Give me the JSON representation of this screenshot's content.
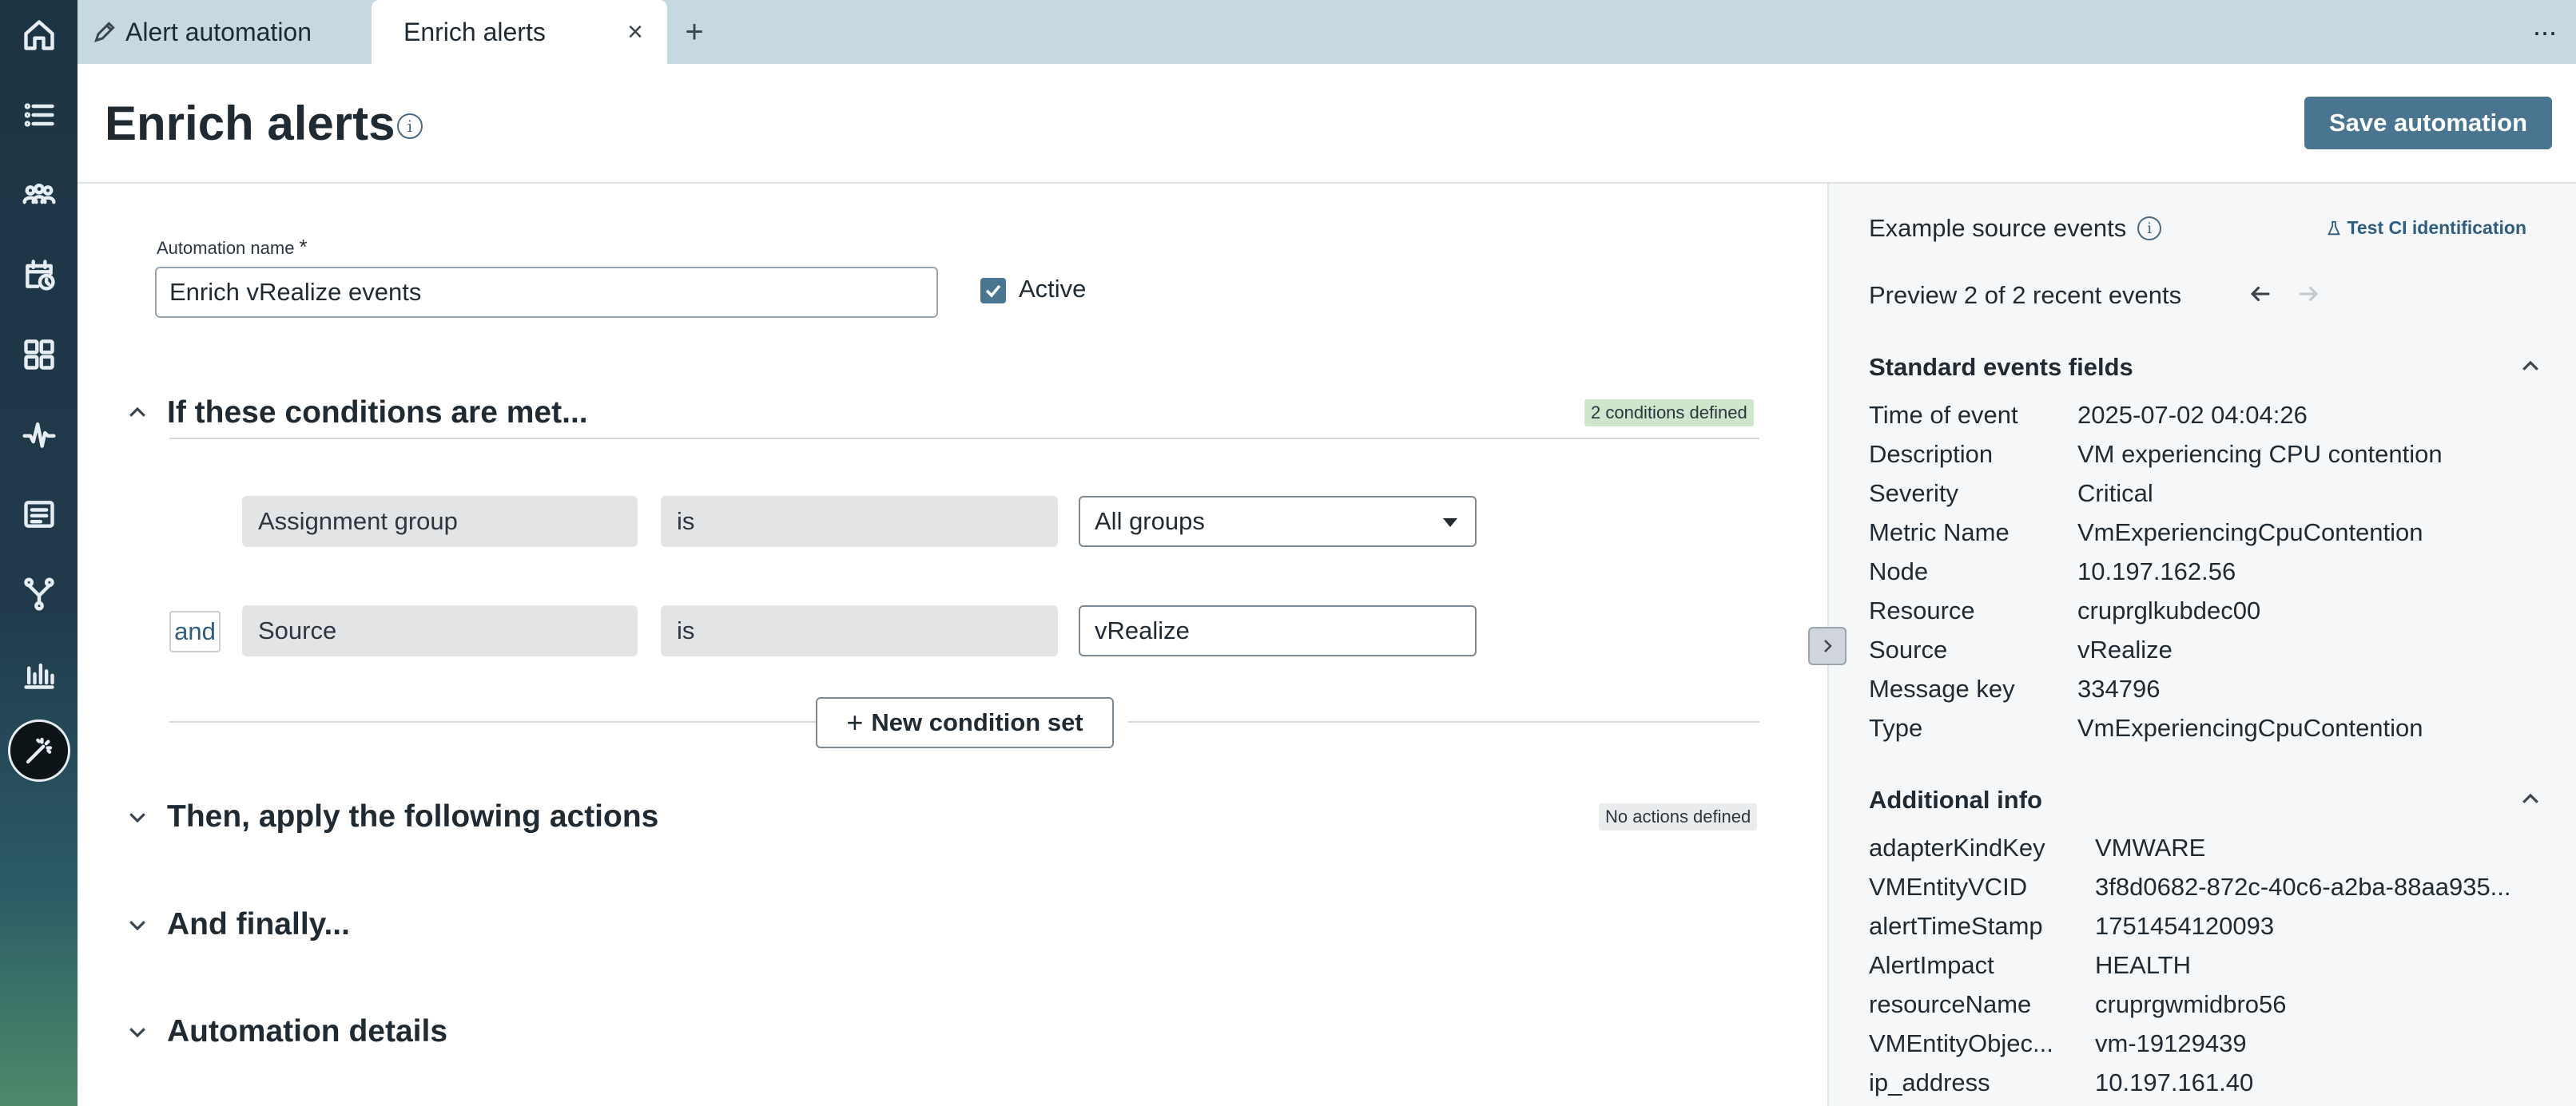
{
  "tabs": [
    {
      "label": "Alert automation"
    },
    {
      "label": "Enrich alerts"
    }
  ],
  "header": {
    "title": "Enrich alerts",
    "info_glyph": "i",
    "save_label": "Save automation"
  },
  "form": {
    "name_label": "Automation name",
    "required_mark": "*",
    "name_value": "Enrich vRealize events",
    "active_label": "Active",
    "active_checked": true
  },
  "conditions": {
    "title": "If these conditions are met...",
    "badge": "2 conditions defined",
    "rows": [
      {
        "field": "Assignment group",
        "operator": "is",
        "value": "All groups",
        "dropdown": true
      },
      {
        "connector": "and",
        "field": "Source",
        "operator": "is",
        "value": "vRealize",
        "dropdown": false
      }
    ],
    "new_condition_label": "New condition set"
  },
  "actions": {
    "title": "Then, apply the following actions",
    "badge": "No actions defined"
  },
  "finally": {
    "title": "And finally..."
  },
  "details": {
    "title": "Automation details"
  },
  "panel": {
    "title": "Example source events",
    "test_ci_label": "Test CI identification",
    "preview_text": "Preview 2 of 2 recent events",
    "standard_title": "Standard events fields",
    "standard_fields": [
      {
        "key": "Time of event",
        "value": "2025-07-02 04:04:26"
      },
      {
        "key": "Description",
        "value": "VM experiencing CPU contention"
      },
      {
        "key": "Severity",
        "value": "Critical"
      },
      {
        "key": "Metric Name",
        "value": "VmExperiencingCpuContention"
      },
      {
        "key": "Node",
        "value": "10.197.162.56"
      },
      {
        "key": "Resource",
        "value": "cruprglkubdec00"
      },
      {
        "key": "Source",
        "value": "vRealize"
      },
      {
        "key": "Message key",
        "value": "334796"
      },
      {
        "key": "Type",
        "value": "VmExperiencingCpuContention"
      }
    ],
    "additional_title": "Additional info",
    "additional_fields": [
      {
        "key": "adapterKindKey",
        "value": "VMWARE"
      },
      {
        "key": "VMEntityVCID",
        "value": "3f8d0682-872c-40c6-a2ba-88aa935..."
      },
      {
        "key": "alertTimeStamp",
        "value": "1751454120093"
      },
      {
        "key": "AlertImpact",
        "value": "HEALTH"
      },
      {
        "key": "resourceName",
        "value": "cruprgwmidbro56"
      },
      {
        "key": "VMEntityObjec...",
        "value": "vm-19129439"
      },
      {
        "key": "ip_address",
        "value": "10.197.161.40"
      }
    ]
  },
  "nav_icons": [
    "home-icon",
    "list-icon",
    "groups-icon",
    "schedule-icon",
    "dashboard-grid-icon",
    "pulse-icon",
    "report-icon",
    "branch-icon",
    "bar-chart-icon",
    "magic-wand-icon"
  ],
  "colors": {
    "accent": "#4a7591",
    "tabbar": "#c6d8e0",
    "rail": "#1d3444",
    "badge_green": "#cfe6cc",
    "badge_grey": "#e9ebed"
  }
}
